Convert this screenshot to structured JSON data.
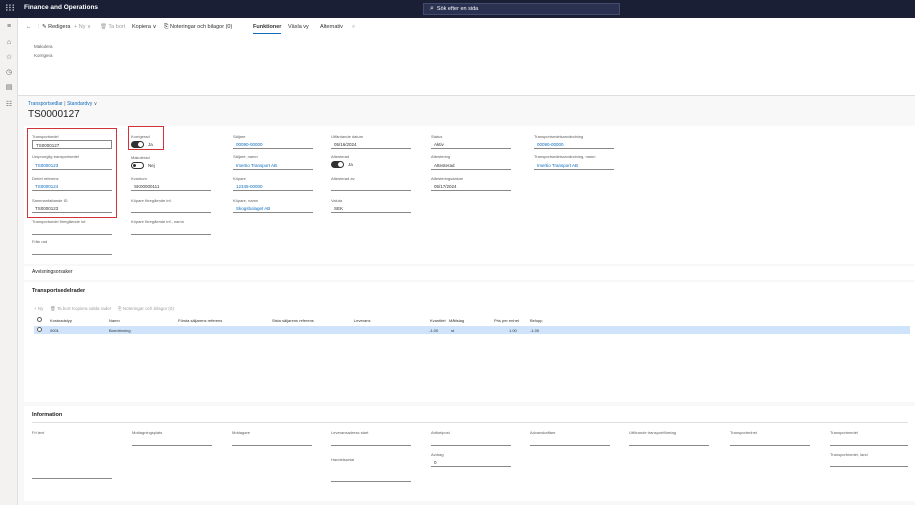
{
  "app": {
    "title": "Finance and Operations",
    "search_placeholder": "Sök efter en sida"
  },
  "toolbar": {
    "back": "←",
    "edit": "Redigera",
    "new": "Ny",
    "delete": "Ta bort",
    "copy": "Kopiera",
    "notes": "Noteringar och bilagor (0)",
    "functions": "Funktioner",
    "view": "Växla vy",
    "options": "Alternativ"
  },
  "functions_menu": [
    "Makulera",
    "Korrigera"
  ],
  "breadcrumb": {
    "module": "Transportsedlar",
    "view": "Standardvy"
  },
  "record_title": "TS0000127",
  "header": {
    "transportsedel_label": "Transportsedel",
    "transportsedel_value": "TS0000127",
    "ursprunglig_label": "Ursprunglig transportsedel",
    "ursprunglig_value": "TS0000123",
    "debit_label": "Debet referens",
    "debit_value": "TS0000124",
    "sammanfattande_label": "Sammanfattande ID",
    "sammanfattande_value": "TS0000123",
    "foregaende_label": "Transportsedel föregående inf.",
    "fran_label": "Från rad",
    "korrigerad_label": "Korrigerad",
    "korrigerad_value": "Ja",
    "makulerad_label": "Makulerad",
    "makulerad_value": "Nej",
    "kvantum_label": "Kvantum",
    "kvantum_value": "SK00000111",
    "kopare_foregaende_label": "Köpare föregående inf.",
    "kopare_foregaende_namn_label": "Köpare föregående inf., namn",
    "saljare_label": "Säljare",
    "saljare_value": "00090-00000",
    "saljare_namn_label": "Säljare, namn",
    "saljare_namn_value": "Imertio Transport AB",
    "kopare_label": "Köpare",
    "kopare_value": "12345-00000",
    "kopare_namn_label": "Köpare, namn",
    "kopare_namn_value": "Skogsbolaget AB",
    "utfardande_label": "Utfärdande datum",
    "utfardande_value": "05/16/2024",
    "attesterad_label": "Attesterad",
    "attesterad_value": "Ja",
    "attesterad_av_label": "Attesterad av",
    "valuta_label": "Valuta",
    "valuta_value": "SEK",
    "status_label": "Status",
    "status_value": "Aktiv",
    "attestering_label": "Attestering",
    "attestering_value": "Attesterad",
    "attestdatum_label": "Attesteringsdatum",
    "attestdatum_value": "05/17/2024",
    "tsa_label": "Transportsedelsanvändning",
    "tsa_value": "00090-00000",
    "tsa_namn_label": "Transportsedelsanvändning, namn",
    "tsa_namn_value": "Imertio Transport AB"
  },
  "sections": {
    "avvisningsorsaker": "Avvisningsorsaker",
    "transportsedelrader": "Transportsedelrader",
    "information": "Information"
  },
  "grid_toolbar": {
    "new": "Ny",
    "delete": "Ta bort",
    "copy_selected": "Kopiera valda rader",
    "notes": "Noteringar och bilagor (0)"
  },
  "grid_columns": [
    "Kostnadstyp",
    "Namn",
    "Första säljarens referens",
    "Sista säljarens referens",
    "Leverans",
    "Kvantitet",
    "Måttslag",
    "Pris per enhet",
    "Belopp"
  ],
  "grid_rows": [
    {
      "kostnadstyp": "0001",
      "namn": "Borrdrivning",
      "kvantitet": "-1.00",
      "mattslag": "st",
      "pris": "1.00",
      "belopp": "-1.00"
    }
  ],
  "information": {
    "fri_text": "Fri text",
    "mottagningsplats": "Mottagningsplats",
    "mottagare": "Mottagare",
    "leveransadress": "Leveransadress start",
    "artikel": "Artikelpost",
    "avdrag": "Avdrag",
    "avdrag_value": "0",
    "handelsavtal": "Handelsavtal",
    "advanskaffa": "Advanskaffare",
    "utforande": "Utförande transportföretag",
    "transportenhet": "Transportenhet",
    "transportmedel": "Transportmedel",
    "transportmedel_land": "Transportmedel, land"
  }
}
